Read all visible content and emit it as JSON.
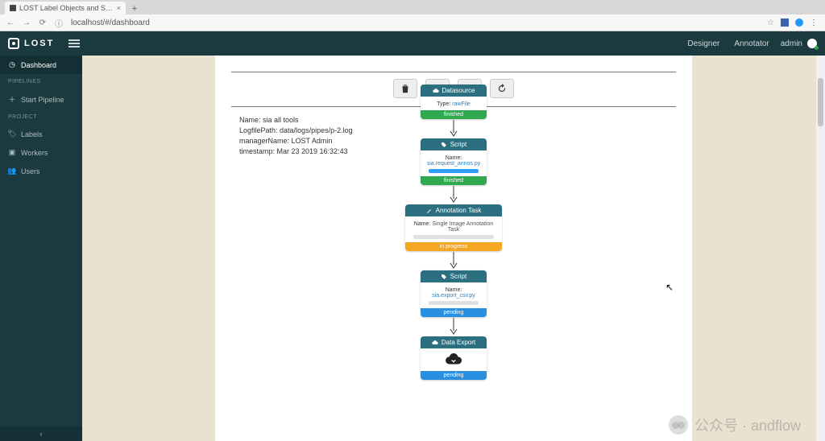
{
  "browser": {
    "tab_title": "LOST Label Objects and S…",
    "url": "localhost/#/dashboard"
  },
  "appbar": {
    "brand": "LOST",
    "links": {
      "designer": "Designer",
      "annotator": "Annotator"
    },
    "user": "admin"
  },
  "sidebar": {
    "dashboard": "Dashboard",
    "hdr_pipelines": "PIPELINES",
    "start_pipeline": "Start Pipeline",
    "hdr_project": "PROJECT",
    "labels": "Labels",
    "workers": "Workers",
    "users": "Users"
  },
  "meta": {
    "l1": "Name: sia all tools",
    "l2": "LogfilePath: data/logs/pipes/p-2.log",
    "l3": "managerName: LOST Admin",
    "l4": "timestamp: Mar 23 2019 16:32:43"
  },
  "nodes": {
    "n1": {
      "title": "Datasource",
      "body_label": "Type:",
      "body_value": "rawFile",
      "status": "finished"
    },
    "n2": {
      "title": "Script",
      "body_label": "Name:",
      "body_value": "sia.request_annos.py",
      "status": "finished"
    },
    "n3": {
      "title": "Annotation Task",
      "body_label": "Name:",
      "body_value": "Single Image Annotation Task",
      "status": "in progress"
    },
    "n4": {
      "title": "Script",
      "body_label": "Name:",
      "body_value": "sia.export_csv.py",
      "status": "pending"
    },
    "n5": {
      "title": "Data Export",
      "status": "pending"
    }
  },
  "watermark": "公众号 · andflow"
}
